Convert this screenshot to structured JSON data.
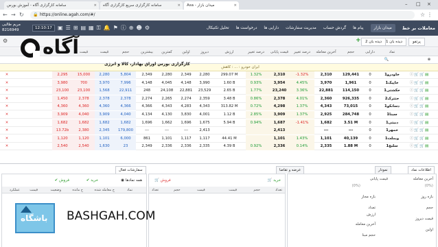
{
  "browser": {
    "tabs": [
      {
        "label": "سامانه کارگزاری آگاه - آموزش بورس"
      },
      {
        "label": "سامانه کارگزاری سریع کارگزاری آگاه"
      },
      {
        "label": "Asa - میدان بازار"
      }
    ],
    "url": "https://online.agah.com/#/",
    "secure_label": "Secure"
  },
  "header": {
    "user_name": "مریم طالبی",
    "user_code": "8216949",
    "clock": "12:10:17",
    "brand": "معاملات بر خط",
    "menu": [
      "میدان بازار",
      "پیام ها",
      "گردش حساب",
      "مدیریت سفارشات",
      "دارایی ها",
      "درخواست ها",
      "تحلیل تکنیکال"
    ],
    "active_menu": "میدان بازار",
    "icons": [
      "settings-icon",
      "user-icon",
      "plus-circle-icon",
      "bell-icon",
      "flag-icon",
      "cart-icon",
      "briefcase-icon",
      "calendar-icon",
      "chart-icon",
      "list-icon",
      "key-icon",
      "mobile-icon",
      "info-icon",
      "lightbulb-icon"
    ]
  },
  "watch": {
    "tabs": [
      "پرتفو",
      "دیده بان 1",
      "دیده بان 2"
    ]
  },
  "logo": {
    "word": "آگاه",
    "tagline": "کارگزاری بورس اوراق بهادار، کالا و انرژی"
  },
  "table": {
    "headers": [
      "",
      "نماد",
      "دارایی",
      "حجم",
      "آخرین معامله",
      "درصد تغییر",
      "قیمت پایانی",
      "درصد تغییر",
      "ارزش",
      "دیروز",
      "اولین",
      "کمترین",
      "بیشترین",
      "حجم",
      "قیمت",
      "قیمت",
      "حجم",
      ""
    ],
    "ticker_text": "ایران خودرو : ... : کاهش",
    "rows": [
      {
        "sym": "خاودرو1",
        "own": "0",
        "vol": "129,441",
        "last": "2,310",
        "lastpct": "-1.32%",
        "close": "2,310",
        "closepct": "1.32%",
        "value": "299.07 M",
        "yest": "2,280",
        "first": "2,349",
        "low": "2,280",
        "high": "2,349",
        "bvol": "5,804",
        "bprice": "2,280",
        "sprice": "15,000",
        "svol": "2,295"
      },
      {
        "sym": "خاپیک1",
        "own": "0",
        "vol": "1,961",
        "last": "3,970",
        "lastpct": "4.45%",
        "close": "3,954",
        "closepct": "0.93%",
        "value": "1.60 B",
        "yest": "3,990",
        "first": "4,148",
        "low": "4,045",
        "high": "4,148",
        "bvol": "7,996",
        "bprice": "3,970",
        "sprice": "700",
        "svol": "3,980"
      },
      {
        "sym": "حکشتی1",
        "own": "0",
        "vol": "114,150",
        "last": "22,881",
        "lastpct": "3.36%",
        "close": "23,240",
        "closepct": "1.77%",
        "value": "2.65 B",
        "yest": "23,529",
        "first": "22,881",
        "low": "24,108",
        "high": "248",
        "bvol": "22,911",
        "bprice": "1,568",
        "sprice": "23,100",
        "svol": "23,100"
      },
      {
        "sym": "حتترک2",
        "own": "0",
        "vol": "926,335",
        "last": "2,360",
        "lastpct": "4.01%",
        "close": "2,378",
        "closepct": "0.86%",
        "value": "3.48 B",
        "yest": "2,359",
        "first": "2,274",
        "low": "2,265",
        "high": "2,274",
        "bvol": "2,378",
        "bprice": "2,378",
        "sprice": "2,378",
        "svol": "1,450"
      },
      {
        "sym": "دسانکو1",
        "own": "0",
        "vol": "73,015",
        "last": "4,343",
        "lastpct": "1.37%",
        "close": "4,298",
        "closepct": "0.72%",
        "value": "313.82 M",
        "yest": "4,343",
        "first": "4,283",
        "low": "4,343",
        "high": "4,366",
        "bvol": "4,366",
        "bprice": "4,360",
        "sprice": "4,360",
        "svol": "4,360"
      },
      {
        "sym": "سبنا1",
        "own": "0",
        "vol": "284,748",
        "last": "2,925",
        "lastpct": "1.37%",
        "close": "3,909",
        "closepct": "2.85%",
        "value": "1.12 B",
        "yest": "4,001",
        "first": "3,830",
        "low": "4,130",
        "high": "4,134",
        "bvol": "4,040",
        "bprice": "3,909",
        "sprice": "4,040",
        "svol": "3,909"
      },
      {
        "sym": "دبیتی1",
        "own": "0",
        "vol": "3.51 M",
        "last": "1,682",
        "lastpct": "-1.41%",
        "close": "1,687",
        "closepct": "0.94%",
        "value": "5.94 B",
        "yest": "1,675",
        "first": "1,696",
        "low": "1,662",
        "high": "1,696",
        "bvol": "1,682",
        "bprice": "1,682",
        "sprice": "1,682",
        "svol": "1,682"
      },
      {
        "sym": "خمهر1",
        "own": "0",
        "vol": "---",
        "last": "---",
        "lastpct": "",
        "close": "2,413",
        "closepct": "",
        "value": "",
        "yest": "2,413",
        "first": "---",
        "low": "---",
        "high": "---",
        "bvol": "179,800",
        "bprice": "2,345",
        "sprice": "2,380",
        "svol": "13.72b"
      },
      {
        "sym": "وبملت1",
        "own": "0",
        "vol": "40,139",
        "last": "1,101",
        "lastpct": "1.43%",
        "close": "1,101",
        "closepct": "",
        "value": "44.41 M",
        "yest": "1,117",
        "first": "1,117",
        "low": "1,101",
        "high": "861",
        "bvol": "6,000",
        "bprice": "1,101",
        "sprice": "1,120",
        "svol": "1,120"
      },
      {
        "sym": "سلنچ1",
        "own": "0",
        "vol": "1.88 M",
        "last": "2,335",
        "lastpct": "0.14%",
        "close": "2,336",
        "closepct": "0.92%",
        "value": "4.39 B",
        "yest": "2,335",
        "first": "2,336",
        "low": "2,336",
        "high": "2,349",
        "bvol": "23",
        "bprice": "1,630",
        "sprice": "2,540",
        "svol": "2,540"
      }
    ]
  },
  "bottom": {
    "left_tabs": [
      "اطلاعات نماد",
      "نمودار",
      "عرضه و تقاضا"
    ],
    "orders_tab": "سفارشات فعال",
    "buy_label": "خرید",
    "sell_label": "فروش",
    "order_filters": [
      "همه نمادها",
      "خرید",
      "فروش"
    ],
    "order_columns": [
      "",
      "نماد",
      "ح معامله شده",
      "ح مانده",
      "وضعیت",
      "قیمت",
      "عملکرد"
    ],
    "depth_columns": [
      "تعداد",
      "حجم",
      "قیمت",
      "قیمت",
      "حجم",
      "تعداد"
    ],
    "info_labels": {
      "last_price": "آخرین معامله",
      "close_price": "قیمت پایانی",
      "pct_zero": "(0%)",
      "range": "بازه روز",
      "allowed_range": "بازه مجاز",
      "volume": "حجم",
      "value": "ارزش",
      "count": "تعداد",
      "yesterday": "قیمت دیروز",
      "last_trade": "آخرین معامله",
      "first": "اولین",
      "base_volume": "حجم مبنا"
    }
  },
  "watermark": {
    "site": "BASHGAH.COM",
    "logo_text": "باشگاه"
  }
}
